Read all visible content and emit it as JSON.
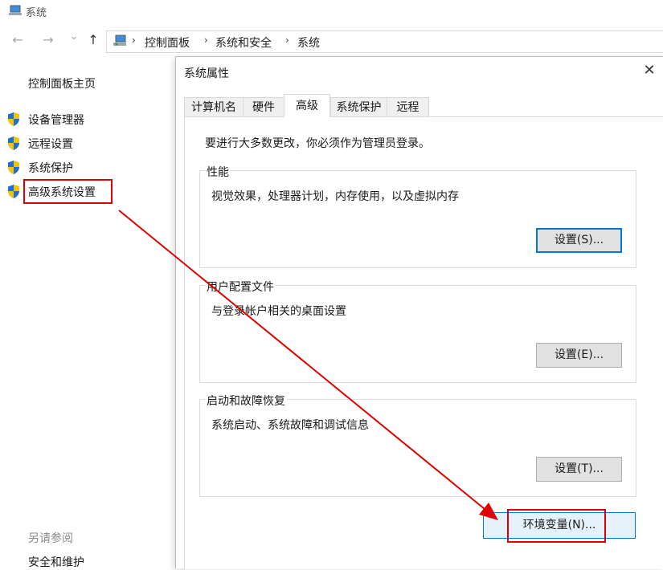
{
  "window": {
    "title": "系统"
  },
  "nav": {
    "back": "←",
    "forward": "→",
    "history": "⌄",
    "up": "↑"
  },
  "breadcrumb": {
    "items": [
      "控制面板",
      "系统和安全",
      "系统"
    ],
    "separator": "›"
  },
  "sidebar": {
    "home": "控制面板主页",
    "items": [
      {
        "label": "设备管理器",
        "icon": "uac-shield-icon"
      },
      {
        "label": "远程设置",
        "icon": "uac-shield-icon"
      },
      {
        "label": "系统保护",
        "icon": "uac-shield-icon"
      },
      {
        "label": "高级系统设置",
        "icon": "uac-shield-icon"
      }
    ],
    "see_also": "另请参阅",
    "see_also_items": [
      "安全和维护"
    ]
  },
  "dialog": {
    "title": "系统属性",
    "close": "✕",
    "tabs": [
      "计算机名",
      "硬件",
      "高级",
      "系统保护",
      "远程"
    ],
    "active_tab": "高级",
    "admin_note": "要进行大多数更改，你必须作为管理员登录。",
    "groups": {
      "performance": {
        "title": "性能",
        "desc": "视觉效果，处理器计划，内存使用，以及虚拟内存",
        "button": "设置(S)..."
      },
      "profiles": {
        "title": "用户配置文件",
        "desc": "与登录帐户相关的桌面设置",
        "button": "设置(E)..."
      },
      "startup": {
        "title": "启动和故障恢复",
        "desc": "系统启动、系统故障和调试信息",
        "button": "设置(T)..."
      }
    },
    "env_button": "环境变量(N)..."
  },
  "colors": {
    "annotation_red": "#e00000",
    "focus_blue": "#0078d7",
    "shield_blue": "#1f6fd6",
    "shield_yellow": "#f5c400"
  }
}
